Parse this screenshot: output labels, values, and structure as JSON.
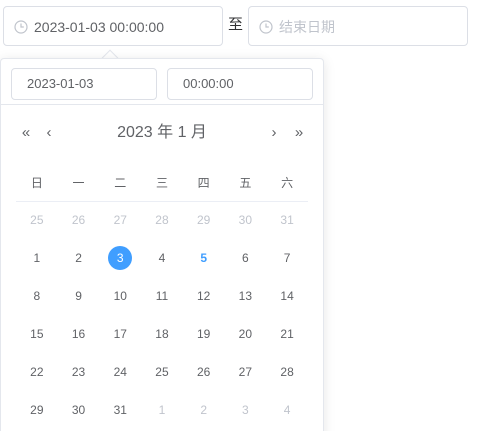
{
  "range": {
    "start_value": "2023-01-03 00:00:00",
    "separator": "至",
    "end_placeholder": "结束日期"
  },
  "picker": {
    "date_value": "2023-01-03",
    "time_value": "00:00:00",
    "header": "2023 年  1 月",
    "nav": {
      "prev_year": "«",
      "prev_month": "‹",
      "next_month": "›",
      "next_year": "»"
    },
    "weekdays": [
      "日",
      "一",
      "二",
      "三",
      "四",
      "五",
      "六"
    ],
    "weeks": [
      [
        [
          "25",
          "prev"
        ],
        [
          "26",
          "prev"
        ],
        [
          "27",
          "prev"
        ],
        [
          "28",
          "prev"
        ],
        [
          "29",
          "prev"
        ],
        [
          "30",
          "prev"
        ],
        [
          "31",
          "prev"
        ]
      ],
      [
        [
          "1",
          "cur"
        ],
        [
          "2",
          "cur"
        ],
        [
          "3",
          "selected"
        ],
        [
          "4",
          "cur"
        ],
        [
          "5",
          "today"
        ],
        [
          "6",
          "cur"
        ],
        [
          "7",
          "cur"
        ]
      ],
      [
        [
          "8",
          "cur"
        ],
        [
          "9",
          "cur"
        ],
        [
          "10",
          "cur"
        ],
        [
          "11",
          "cur"
        ],
        [
          "12",
          "cur"
        ],
        [
          "13",
          "cur"
        ],
        [
          "14",
          "cur"
        ]
      ],
      [
        [
          "15",
          "cur"
        ],
        [
          "16",
          "cur"
        ],
        [
          "17",
          "cur"
        ],
        [
          "18",
          "cur"
        ],
        [
          "19",
          "cur"
        ],
        [
          "20",
          "cur"
        ],
        [
          "21",
          "cur"
        ]
      ],
      [
        [
          "22",
          "cur"
        ],
        [
          "23",
          "cur"
        ],
        [
          "24",
          "cur"
        ],
        [
          "25",
          "cur"
        ],
        [
          "26",
          "cur"
        ],
        [
          "27",
          "cur"
        ],
        [
          "28",
          "cur"
        ]
      ],
      [
        [
          "29",
          "cur"
        ],
        [
          "30",
          "cur"
        ],
        [
          "31",
          "cur"
        ],
        [
          "1",
          "next"
        ],
        [
          "2",
          "next"
        ],
        [
          "3",
          "next"
        ],
        [
          "4",
          "next"
        ]
      ]
    ]
  },
  "colors": {
    "accent": "#409eff",
    "text": "#606266",
    "muted": "#c0c4cc",
    "border": "#dcdfe6"
  },
  "icons": {
    "input_prefix": "clock-icon"
  }
}
